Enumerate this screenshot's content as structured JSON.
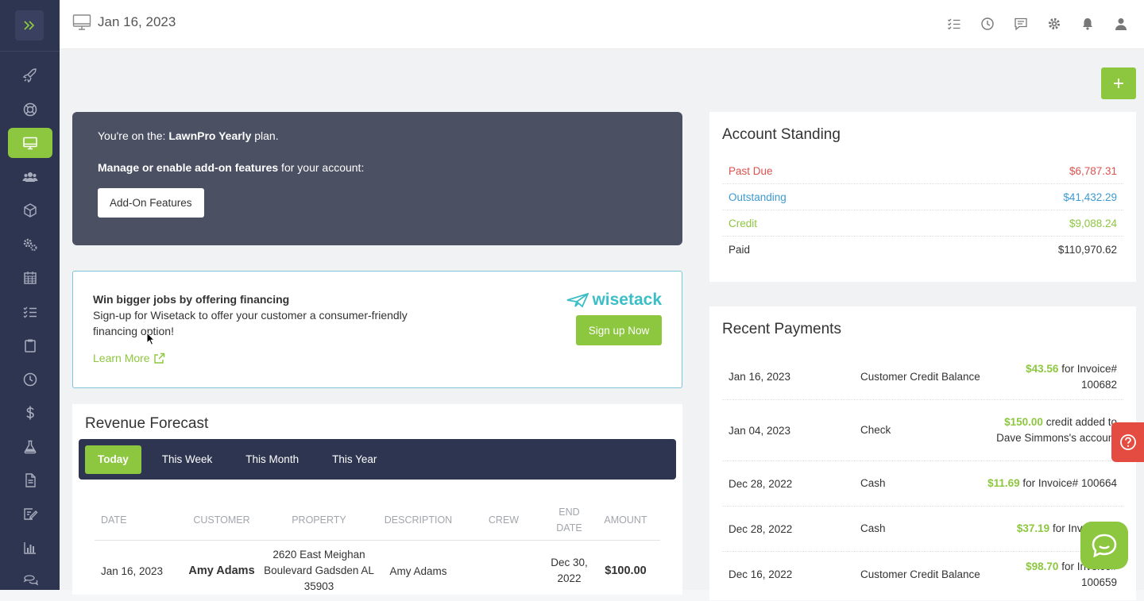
{
  "header": {
    "date": "Jan 16, 2023"
  },
  "plan": {
    "prefix": "You're on the: ",
    "plan_name": "LawnPro Yearly",
    "suffix": " plan.",
    "manage_bold": "Manage or enable add-on features",
    "manage_rest": " for your account:",
    "addon_button": "Add-On Features"
  },
  "wisetack": {
    "title": "Win bigger jobs by offering financing",
    "text": "Sign-up for Wisetack to offer your customer a consumer-friendly financing option!",
    "learn_more": "Learn More",
    "logo": "wisetack",
    "signup_button": "Sign up Now"
  },
  "revenue": {
    "title": "Revenue Forecast",
    "tabs": [
      {
        "label": "Today",
        "active": true
      },
      {
        "label": "This Week",
        "active": false
      },
      {
        "label": "This Month",
        "active": false
      },
      {
        "label": "This Year",
        "active": false
      }
    ],
    "columns": [
      "DATE",
      "CUSTOMER",
      "PROPERTY",
      "DESCRIPTION",
      "CREW",
      "END DATE",
      "AMOUNT"
    ],
    "rows": [
      {
        "date": "Jan 16, 2023",
        "customer": "Amy Adams",
        "property": "2620 East Meighan Boulevard Gadsden AL 35903",
        "description": "Amy Adams",
        "crew": "",
        "end_date": "Dec 30, 2022",
        "amount": "$100.00"
      }
    ]
  },
  "account": {
    "title": "Account Standing",
    "rows": [
      {
        "label": "Past Due",
        "value": "$6,787.31",
        "color": "#d9534f"
      },
      {
        "label": "Outstanding",
        "value": "$41,432.29",
        "color": "#3d9ad1"
      },
      {
        "label": "Credit",
        "value": "$9,088.24",
        "color": "#8dc63f"
      },
      {
        "label": "Paid",
        "value": "$110,970.62",
        "color": "#333333"
      }
    ]
  },
  "payments": {
    "title": "Recent Payments",
    "rows": [
      {
        "date": "Jan 16, 2023",
        "type": "Customer Credit Balance",
        "amount": "$43.56",
        "detail": "for Invoice# 100682"
      },
      {
        "date": "Jan 04, 2023",
        "type": "Check",
        "amount": "$150.00",
        "detail": "credit added to Dave Simmons's account"
      },
      {
        "date": "Dec 28, 2022",
        "type": "Cash",
        "amount": "$11.69",
        "detail": "for Invoice# 100664"
      },
      {
        "date": "Dec 28, 2022",
        "type": "Cash",
        "amount": "$37.19",
        "detail": "for Invoice# 1"
      },
      {
        "date": "Dec 16, 2022",
        "type": "Customer Credit Balance",
        "amount": "$98.70",
        "detail": "for Invoice# 100659"
      }
    ]
  },
  "colors": {
    "sidebar": "#2e3550",
    "accent": "#8dc63f",
    "help": "#e44c41",
    "wisetack": "#3cbec6"
  },
  "icons": {
    "sidebar": [
      "rocket-icon",
      "lifebuoy-icon",
      "monitor-icon",
      "users-icon",
      "box-icon",
      "gears-icon",
      "calendar-icon",
      "checklist-icon",
      "clipboard-icon",
      "clock-icon",
      "dollar-icon",
      "flask-icon",
      "document-icon",
      "edit-icon",
      "chart-icon",
      "chat-icon"
    ],
    "topbar": [
      "tasks-icon",
      "history-icon",
      "messages-icon",
      "settings-icon",
      "bell-icon",
      "user-icon"
    ]
  }
}
